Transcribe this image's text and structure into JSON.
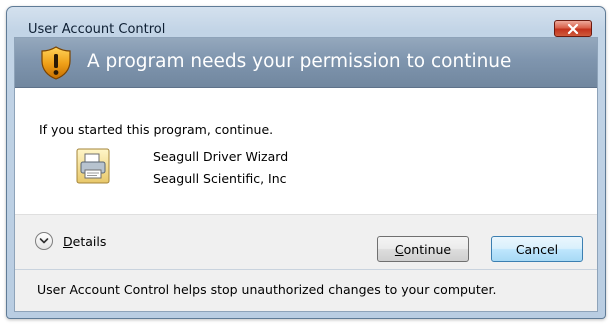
{
  "window": {
    "title": "User Account Control",
    "close_icon": "close-x-icon"
  },
  "banner": {
    "icon": "uac-shield-warning-icon",
    "heading": "A program needs your permission to continue"
  },
  "body": {
    "intro": "If you started this program, continue.",
    "program": {
      "icon": "printer-driver-icon",
      "name": "Seagull Driver Wizard",
      "publisher": "Seagull Scientific, Inc"
    }
  },
  "actions": {
    "details_icon": "chevron-down-circle-icon",
    "details_label": "Details",
    "continue_label": "Continue",
    "cancel_label": "Cancel"
  },
  "footer": {
    "text": "User Account Control helps stop unauthorized changes to your computer."
  },
  "colors": {
    "banner": "#7f95ae",
    "close_button": "#c3321d",
    "default_button_border": "#3c7fb1",
    "button_area": "#f0f0f0"
  }
}
